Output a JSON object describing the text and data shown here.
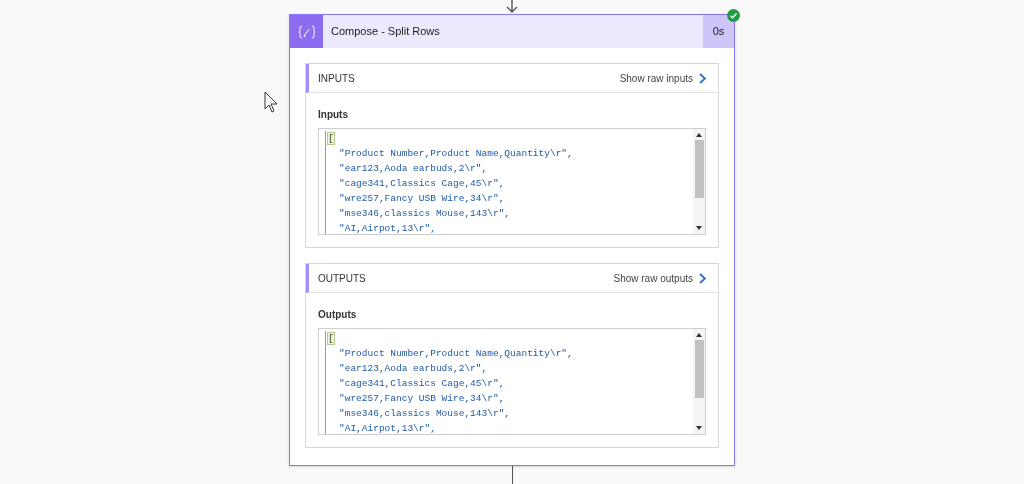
{
  "header": {
    "title": "Compose - Split Rows",
    "duration": "0s",
    "succeeded": true
  },
  "sections": [
    {
      "heading": "INPUTS",
      "link": "Show raw inputs",
      "label": "Inputs",
      "bracket": "[",
      "lines": [
        "\"Product Number,Product Name,Quantity\\r\",",
        "\"ear123,Aoda earbuds,2\\r\",",
        "\"cage341,Classics Cage,45\\r\",",
        "\"wre257,Fancy USB Wire,34\\r\",",
        "\"mse346,classics Mouse,143\\r\",",
        "\"AI,Airpot,13\\r\","
      ]
    },
    {
      "heading": "OUTPUTS",
      "link": "Show raw outputs",
      "label": "Outputs",
      "bracket": "[",
      "lines": [
        "\"Product Number,Product Name,Quantity\\r\",",
        "\"ear123,Aoda earbuds,2\\r\",",
        "\"cage341,Classics Cage,45\\r\",",
        "\"wre257,Fancy USB Wire,34\\r\",",
        "\"mse346,classics Mouse,143\\r\",",
        "\"AI,Airpot,13\\r\","
      ]
    }
  ]
}
